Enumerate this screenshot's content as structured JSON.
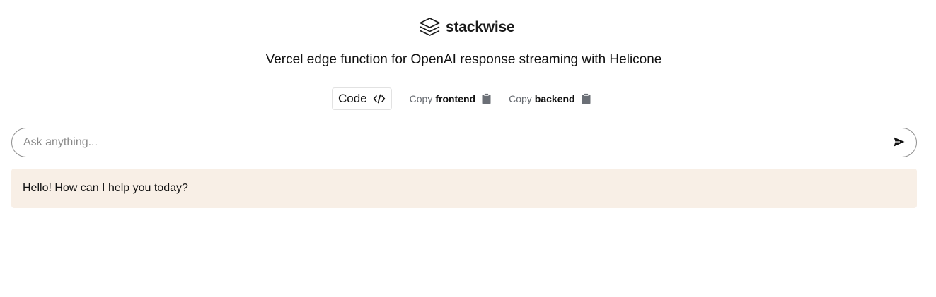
{
  "brand": {
    "name": "stackwise",
    "icon": "stack-layers-icon"
  },
  "page": {
    "title": "Vercel edge function for OpenAI response streaming with Helicone"
  },
  "actions": {
    "code_label": "Code",
    "code_icon": "code-brackets-icon",
    "copy_frontend": {
      "prefix": "Copy",
      "target": "frontend",
      "icon": "clipboard-icon"
    },
    "copy_backend": {
      "prefix": "Copy",
      "target": "backend",
      "icon": "clipboard-icon"
    }
  },
  "search": {
    "placeholder": "Ask anything...",
    "value": "",
    "send_icon": "send-icon"
  },
  "messages": [
    {
      "text": "Hello! How can I help you today?"
    }
  ],
  "colors": {
    "message_bg": "#f8efe6",
    "muted_text": "#666a70",
    "border": "#8e8e8e"
  }
}
